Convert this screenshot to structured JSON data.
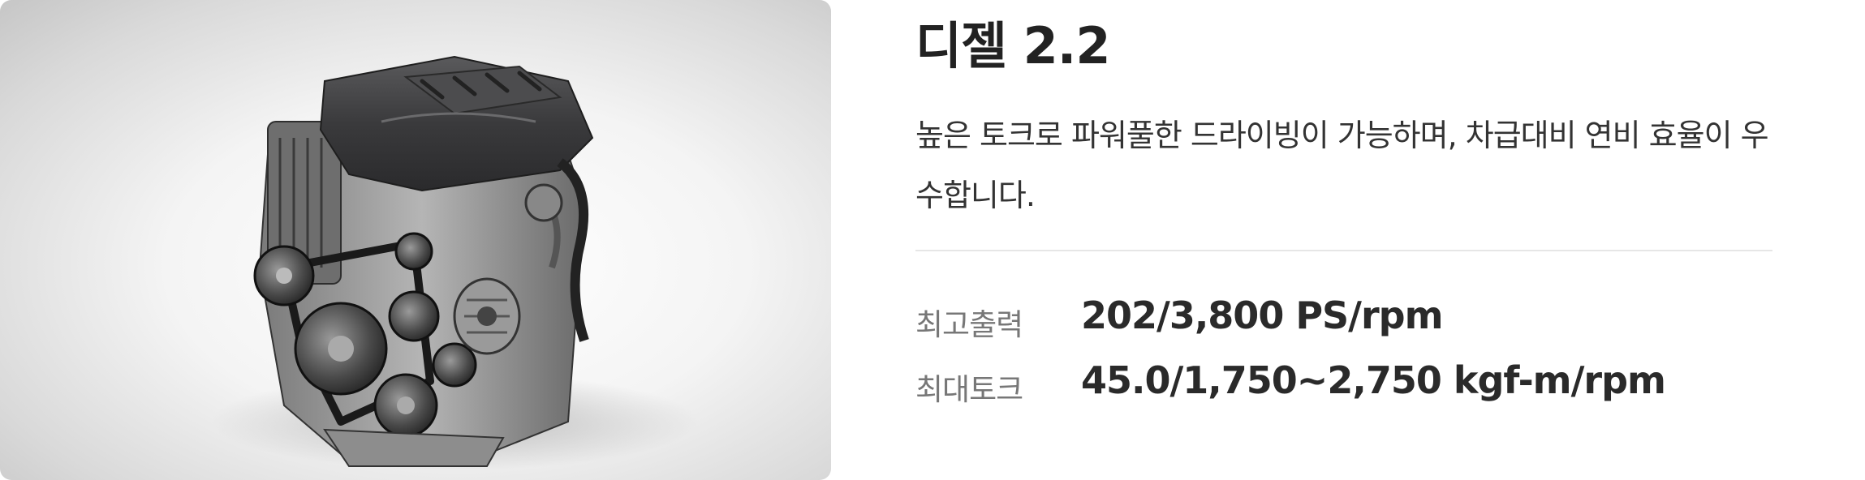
{
  "engine": {
    "title": "디젤 2.2",
    "description": "높은 토크로 파워풀한 드라이빙이 가능하며, 차급대비 연비 효율이 우수합니다.",
    "specs": [
      {
        "label": "최고출력",
        "value": "202/3,800 PS/rpm"
      },
      {
        "label": "최대토크",
        "value": "45.0/1,750~2,750 kgf-m/rpm"
      }
    ],
    "image": {
      "icon": "engine-image"
    }
  }
}
